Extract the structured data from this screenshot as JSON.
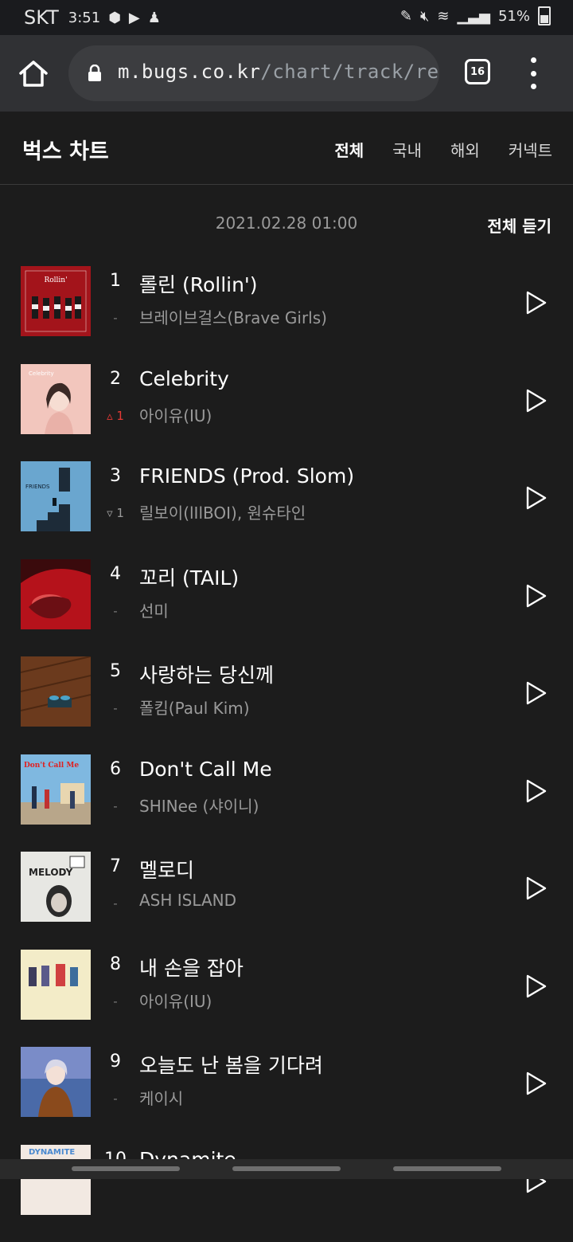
{
  "status_bar": {
    "carrier": "SKT",
    "time": "3:51",
    "battery": "51%"
  },
  "browser": {
    "url_host": "m.bugs.co.kr",
    "url_path": "/chart/track/real",
    "tab_count": "16"
  },
  "chart": {
    "title": "벅스 차트",
    "tabs": [
      "전체",
      "국내",
      "해외",
      "커넥트"
    ],
    "active_tab": "전체",
    "timestamp": "2021.02.28 01:00",
    "listen_all": "전체 듣기"
  },
  "tracks": [
    {
      "rank": "1",
      "change": "-",
      "title": "롤린 (Rollin')",
      "artist": "브레이브걸스(Brave Girls)"
    },
    {
      "rank": "2",
      "change": "▵ 1",
      "change_dir": "up",
      "title": "Celebrity",
      "artist": "아이유(IU)"
    },
    {
      "rank": "3",
      "change": "▿ 1",
      "change_dir": "down",
      "title": "FRIENDS (Prod. Slom)",
      "artist": "릴보이(lIlBOI), 원슈타인"
    },
    {
      "rank": "4",
      "change": "-",
      "title": "꼬리 (TAIL)",
      "artist": "선미"
    },
    {
      "rank": "5",
      "change": "-",
      "title": "사랑하는 당신께",
      "artist": "폴킴(Paul Kim)"
    },
    {
      "rank": "6",
      "change": "-",
      "title": "Don't Call Me",
      "artist": "SHINee (샤이니)"
    },
    {
      "rank": "7",
      "change": "-",
      "title": "멜로디",
      "artist": "ASH ISLAND"
    },
    {
      "rank": "8",
      "change": "-",
      "title": "내 손을 잡아",
      "artist": "아이유(IU)"
    },
    {
      "rank": "9",
      "change": "-",
      "title": "오늘도 난 봄을 기다려",
      "artist": "케이시"
    },
    {
      "rank": "10",
      "change": "",
      "title": "Dynamite",
      "artist": ""
    }
  ],
  "album_art_text": {
    "1": "Rollin'",
    "2": "Celebrity",
    "3": "FRIENDS",
    "6": "Don't Call Me",
    "7": "MELODY",
    "10": "DYNAMITE"
  }
}
